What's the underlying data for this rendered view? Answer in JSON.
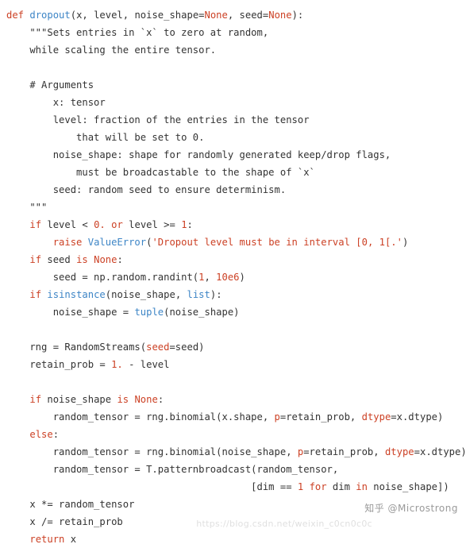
{
  "document": {
    "type": "code-listing",
    "language": "python",
    "lines": [
      [
        {
          "t": "def ",
          "c": "kw"
        },
        {
          "t": "dropout",
          "c": "fn"
        },
        {
          "t": "(x, level, noise_shape=",
          "c": "plain"
        },
        {
          "t": "None",
          "c": "none"
        },
        {
          "t": ", seed=",
          "c": "plain"
        },
        {
          "t": "None",
          "c": "none"
        },
        {
          "t": "):",
          "c": "plain"
        }
      ],
      [
        {
          "t": "    \"\"\"Sets entries in `x` to zero at random,",
          "c": "cmt"
        }
      ],
      [
        {
          "t": "    while scaling the entire tensor.",
          "c": "cmt"
        }
      ],
      [
        {
          "t": "",
          "c": "plain"
        }
      ],
      [
        {
          "t": "    # Arguments",
          "c": "cmt"
        }
      ],
      [
        {
          "t": "        x: tensor",
          "c": "cmt"
        }
      ],
      [
        {
          "t": "        level: fraction of the entries in the tensor",
          "c": "cmt"
        }
      ],
      [
        {
          "t": "            that will be set to 0.",
          "c": "cmt"
        }
      ],
      [
        {
          "t": "        noise_shape: shape for randomly generated keep/drop flags,",
          "c": "cmt"
        }
      ],
      [
        {
          "t": "            must be broadcastable to the shape of `x`",
          "c": "cmt"
        }
      ],
      [
        {
          "t": "        seed: random seed to ensure determinism.",
          "c": "cmt"
        }
      ],
      [
        {
          "t": "    \"\"\"",
          "c": "cmt"
        }
      ],
      [
        {
          "t": "    ",
          "c": "plain"
        },
        {
          "t": "if",
          "c": "kw"
        },
        {
          "t": " level < ",
          "c": "plain"
        },
        {
          "t": "0.",
          "c": "num"
        },
        {
          "t": " ",
          "c": "plain"
        },
        {
          "t": "or",
          "c": "kw"
        },
        {
          "t": " level >= ",
          "c": "plain"
        },
        {
          "t": "1",
          "c": "num"
        },
        {
          "t": ":",
          "c": "plain"
        }
      ],
      [
        {
          "t": "        ",
          "c": "plain"
        },
        {
          "t": "raise",
          "c": "kw"
        },
        {
          "t": " ",
          "c": "plain"
        },
        {
          "t": "ValueError",
          "c": "bi"
        },
        {
          "t": "(",
          "c": "plain"
        },
        {
          "t": "'Dropout level must be in interval [0, 1[.'",
          "c": "str"
        },
        {
          "t": ")",
          "c": "plain"
        }
      ],
      [
        {
          "t": "    ",
          "c": "plain"
        },
        {
          "t": "if",
          "c": "kw"
        },
        {
          "t": " seed ",
          "c": "plain"
        },
        {
          "t": "is",
          "c": "kw"
        },
        {
          "t": " ",
          "c": "plain"
        },
        {
          "t": "None",
          "c": "none"
        },
        {
          "t": ":",
          "c": "plain"
        }
      ],
      [
        {
          "t": "        seed = np.random.randint(",
          "c": "plain"
        },
        {
          "t": "1",
          "c": "num"
        },
        {
          "t": ", ",
          "c": "plain"
        },
        {
          "t": "10e6",
          "c": "num"
        },
        {
          "t": ")",
          "c": "plain"
        }
      ],
      [
        {
          "t": "    ",
          "c": "plain"
        },
        {
          "t": "if",
          "c": "kw"
        },
        {
          "t": " ",
          "c": "plain"
        },
        {
          "t": "isinstance",
          "c": "bi"
        },
        {
          "t": "(noise_shape, ",
          "c": "plain"
        },
        {
          "t": "list",
          "c": "bi"
        },
        {
          "t": "):",
          "c": "plain"
        }
      ],
      [
        {
          "t": "        noise_shape = ",
          "c": "plain"
        },
        {
          "t": "tuple",
          "c": "bi"
        },
        {
          "t": "(noise_shape)",
          "c": "plain"
        }
      ],
      [
        {
          "t": "",
          "c": "plain"
        }
      ],
      [
        {
          "t": "    rng = RandomStreams(",
          "c": "plain"
        },
        {
          "t": "seed",
          "c": "kwarg"
        },
        {
          "t": "=seed)",
          "c": "plain"
        }
      ],
      [
        {
          "t": "    retain_prob = ",
          "c": "plain"
        },
        {
          "t": "1.",
          "c": "num"
        },
        {
          "t": " - level",
          "c": "plain"
        }
      ],
      [
        {
          "t": "",
          "c": "plain"
        }
      ],
      [
        {
          "t": "    ",
          "c": "plain"
        },
        {
          "t": "if",
          "c": "kw"
        },
        {
          "t": " noise_shape ",
          "c": "plain"
        },
        {
          "t": "is",
          "c": "kw"
        },
        {
          "t": " ",
          "c": "plain"
        },
        {
          "t": "None",
          "c": "none"
        },
        {
          "t": ":",
          "c": "plain"
        }
      ],
      [
        {
          "t": "        random_tensor = rng.binomial(x.shape, ",
          "c": "plain"
        },
        {
          "t": "p",
          "c": "kwarg"
        },
        {
          "t": "=retain_prob, ",
          "c": "plain"
        },
        {
          "t": "dtype",
          "c": "kwarg"
        },
        {
          "t": "=x.dtype)",
          "c": "plain"
        }
      ],
      [
        {
          "t": "    ",
          "c": "plain"
        },
        {
          "t": "else",
          "c": "kw"
        },
        {
          "t": ":",
          "c": "plain"
        }
      ],
      [
        {
          "t": "        random_tensor = rng.binomial(noise_shape, ",
          "c": "plain"
        },
        {
          "t": "p",
          "c": "kwarg"
        },
        {
          "t": "=retain_prob, ",
          "c": "plain"
        },
        {
          "t": "dtype",
          "c": "kwarg"
        },
        {
          "t": "=x.dtype)",
          "c": "plain"
        }
      ],
      [
        {
          "t": "        random_tensor = T.patternbroadcast(random_tensor,",
          "c": "plain"
        }
      ],
      [
        {
          "t": "                                          [dim == ",
          "c": "plain"
        },
        {
          "t": "1",
          "c": "num"
        },
        {
          "t": " ",
          "c": "plain"
        },
        {
          "t": "for",
          "c": "kw"
        },
        {
          "t": " dim ",
          "c": "plain"
        },
        {
          "t": "in",
          "c": "kw"
        },
        {
          "t": " noise_shape])",
          "c": "plain"
        }
      ],
      [
        {
          "t": "    x *= random_tensor",
          "c": "plain"
        }
      ],
      [
        {
          "t": "    x /= retain_prob",
          "c": "plain"
        }
      ],
      [
        {
          "t": "    ",
          "c": "plain"
        },
        {
          "t": "return",
          "c": "kw"
        },
        {
          "t": " x",
          "c": "plain"
        }
      ]
    ]
  },
  "watermarks": {
    "zhihu": "知乎 @Microstrong",
    "csdn": "https://blog.csdn.net/weixin_c0cn0c0c"
  },
  "colors": {
    "background": "#ffffff",
    "text": "#333333",
    "keyword": "#cc4125",
    "function": "#3d85c6",
    "string": "#cc4125",
    "number": "#cc4125",
    "watermark_zhihu": "#9a9a9a",
    "watermark_csdn": "#e0e0e0"
  }
}
